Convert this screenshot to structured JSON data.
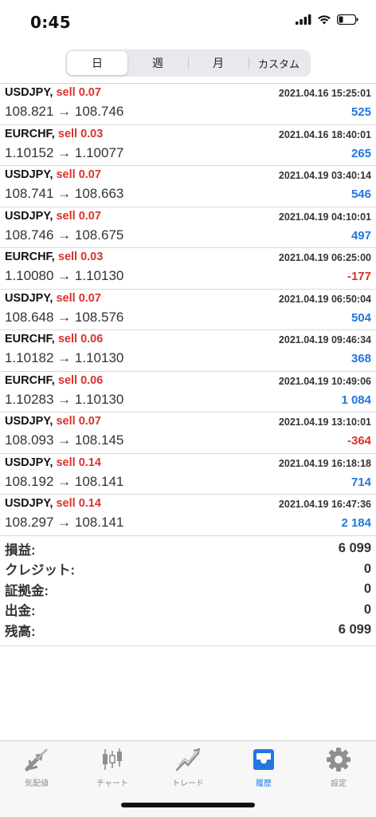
{
  "status": {
    "time": "0:45"
  },
  "segments": [
    "日",
    "週",
    "月",
    "カスタム"
  ],
  "trades": [
    {
      "symbol": "USDJPY,",
      "side": "sell 0.07",
      "date": "2021.04.16 15:25:01",
      "prices": "108.821 → 108.746",
      "profit": "525",
      "negative": false
    },
    {
      "symbol": "EURCHF,",
      "side": "sell 0.03",
      "date": "2021.04.16 18:40:01",
      "prices": "1.10152 → 1.10077",
      "profit": "265",
      "negative": false
    },
    {
      "symbol": "USDJPY,",
      "side": "sell 0.07",
      "date": "2021.04.19 03:40:14",
      "prices": "108.741 → 108.663",
      "profit": "546",
      "negative": false
    },
    {
      "symbol": "USDJPY,",
      "side": "sell 0.07",
      "date": "2021.04.19 04:10:01",
      "prices": "108.746 → 108.675",
      "profit": "497",
      "negative": false
    },
    {
      "symbol": "EURCHF,",
      "side": "sell 0.03",
      "date": "2021.04.19 06:25:00",
      "prices": "1.10080 → 1.10130",
      "profit": "-177",
      "negative": true
    },
    {
      "symbol": "USDJPY,",
      "side": "sell 0.07",
      "date": "2021.04.19 06:50:04",
      "prices": "108.648 → 108.576",
      "profit": "504",
      "negative": false
    },
    {
      "symbol": "EURCHF,",
      "side": "sell 0.06",
      "date": "2021.04.19 09:46:34",
      "prices": "1.10182 → 1.10130",
      "profit": "368",
      "negative": false
    },
    {
      "symbol": "EURCHF,",
      "side": "sell 0.06",
      "date": "2021.04.19 10:49:06",
      "prices": "1.10283 → 1.10130",
      "profit": "1 084",
      "negative": false
    },
    {
      "symbol": "USDJPY,",
      "side": "sell 0.07",
      "date": "2021.04.19 13:10:01",
      "prices": "108.093 → 108.145",
      "profit": "-364",
      "negative": true
    },
    {
      "symbol": "USDJPY,",
      "side": "sell 0.14",
      "date": "2021.04.19 16:18:18",
      "prices": "108.192 → 108.141",
      "profit": "714",
      "negative": false
    },
    {
      "symbol": "USDJPY,",
      "side": "sell 0.14",
      "date": "2021.04.19 16:47:36",
      "prices": "108.297 → 108.141",
      "profit": "2 184",
      "negative": false
    }
  ],
  "summary": [
    {
      "label": "損益:",
      "value": "6 099"
    },
    {
      "label": "クレジット:",
      "value": "0"
    },
    {
      "label": "証拠金:",
      "value": "0"
    },
    {
      "label": "出金:",
      "value": "0"
    },
    {
      "label": "残高:",
      "value": "6 099"
    }
  ],
  "tabs": [
    {
      "label": "気配値",
      "icon": "quotes-arrows-icon"
    },
    {
      "label": "チャート",
      "icon": "candlestick-icon"
    },
    {
      "label": "トレード",
      "icon": "trade-chart-icon"
    },
    {
      "label": "履歴",
      "icon": "history-tray-icon"
    },
    {
      "label": "設定",
      "icon": "gear-icon"
    }
  ],
  "colors": {
    "accent": "#2277e0",
    "negative": "#d8342c",
    "inactive": "#8e8e93"
  }
}
